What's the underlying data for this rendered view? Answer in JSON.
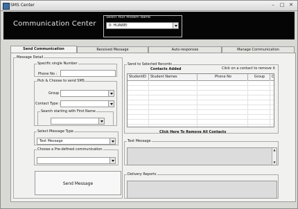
{
  "window": {
    "title": "SMS Center",
    "minimize": "–",
    "maximize": "□",
    "close": "✕"
  },
  "header": {
    "title": "Communication Center",
    "modem_label": "Select Your Modem Name",
    "modem_value": "0: HUAWEI"
  },
  "tabs": [
    {
      "label": "Send Communication",
      "active": true
    },
    {
      "label": "Received Message",
      "active": false
    },
    {
      "label": "Auto-responses",
      "active": false
    },
    {
      "label": "Manage Communication",
      "active": false
    }
  ],
  "message_detail": {
    "legend": "Message Detail",
    "specific": {
      "legend": "Specific single Number",
      "phone_label": "Phone No :",
      "phone_value": ""
    },
    "pick_contacts": {
      "legend": "Pick & Choose to send SMS",
      "group_label": "Group",
      "group_value": "",
      "contact_type_label": "Contact Type :",
      "contact_type_value": "",
      "search_label": "Search starting with First Name",
      "search_value": ""
    },
    "message_type": {
      "legend": "Select Message Type",
      "value": "Text Message"
    },
    "preferred": {
      "legend": "Choose a Pre-defined communication",
      "value": ""
    },
    "send_button": "Send Message"
  },
  "send_to": {
    "legend": "Send to Selected Records",
    "contacts_added": "Contacts Added",
    "click_remove": "Click on a contact to remove it",
    "columns": [
      "StudentID",
      "Student Names",
      "Phone No",
      "Group",
      "Co"
    ],
    "remove_all": "Click Here To Remove All Contacts"
  },
  "text_message": {
    "legend": "Text Message",
    "value": ""
  },
  "delivery": {
    "legend": "Delivery Reports",
    "value": ""
  }
}
